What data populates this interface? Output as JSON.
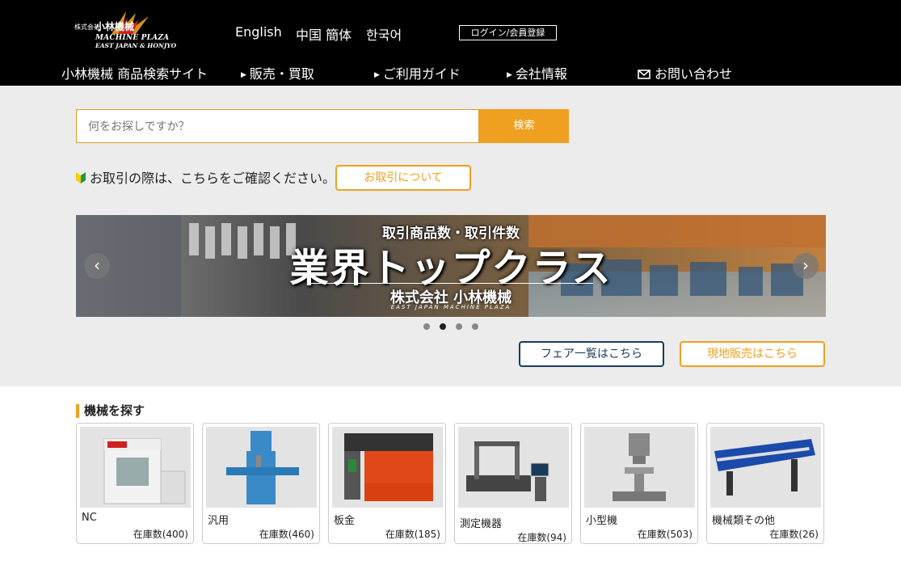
{
  "header": {
    "logo": {
      "kabushiki": "株式会社",
      "brand": "小林機械",
      "line1": "MACHINE PLAZA",
      "line2": "EAST JAPAN & HONJYO"
    },
    "languages": [
      "English",
      "中国 簡体",
      "한국어"
    ],
    "login_label": "ログイン/会員登録",
    "nav": {
      "site_title": "小林機械 商品検索サイト",
      "sales": "販売・買取",
      "guide": "ご利用ガイド",
      "company": "会社情報",
      "contact": "お問い合わせ"
    }
  },
  "search": {
    "placeholder": "何をお探しですか？",
    "button_label": "検索"
  },
  "notice": {
    "text": "お取引の際は、こちらをご確認ください。",
    "button_label": "お取引について"
  },
  "banner": {
    "subtitle": "取引商品数・取引件数",
    "headline": "業界トップクラス",
    "company": "株式会社 小林機械",
    "company_en": "EAST JAPAN MACHINE PLAZA",
    "slides": 4,
    "active_slide": 2
  },
  "buttons": {
    "fair": "フェア一覧はこちら",
    "local": "現地販売はこちら"
  },
  "machines": {
    "title": "機械を探す",
    "categories": [
      {
        "name": "NC",
        "stock": "在庫数(400)"
      },
      {
        "name": "汎用",
        "stock": "在庫数(460)"
      },
      {
        "name": "板金",
        "stock": "在庫数(185)"
      },
      {
        "name": "測定機器",
        "stock": "在庫数(94)"
      },
      {
        "name": "小型機",
        "stock": "在庫数(503)"
      },
      {
        "name": "機械類その他",
        "stock": "在庫数(26)"
      }
    ]
  },
  "colors": {
    "accent": "#f0a020",
    "navy": "#1b3a5c",
    "header_bg": "#000000",
    "section_bg": "#ececec"
  }
}
